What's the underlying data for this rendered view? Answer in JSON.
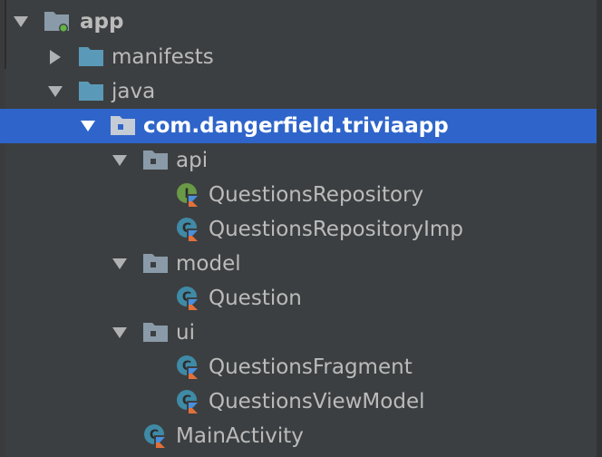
{
  "tree": {
    "root": {
      "label": "app",
      "icon": "module-folder-icon"
    },
    "manifests": {
      "label": "manifests",
      "icon": "folder-icon"
    },
    "java": {
      "label": "java",
      "icon": "source-folder-icon"
    },
    "package": {
      "label": "com.dangerfield.triviaapp",
      "icon": "package-icon"
    },
    "api": {
      "label": "api",
      "icon": "package-icon"
    },
    "questions_repository": {
      "label": "QuestionsRepository",
      "icon": "kotlin-interface-icon"
    },
    "questions_repository_imp": {
      "label": "QuestionsRepositoryImp",
      "icon": "kotlin-class-icon"
    },
    "model": {
      "label": "model",
      "icon": "package-icon"
    },
    "question": {
      "label": "Question",
      "icon": "kotlin-class-icon"
    },
    "ui": {
      "label": "ui",
      "icon": "package-icon"
    },
    "questions_fragment": {
      "label": "QuestionsFragment",
      "icon": "kotlin-class-icon"
    },
    "questions_view_model": {
      "label": "QuestionsViewModel",
      "icon": "kotlin-class-icon"
    },
    "main_activity": {
      "label": "MainActivity",
      "icon": "kotlin-class-icon"
    }
  },
  "colors": {
    "background": "#3c3f41",
    "selection": "#2f65ca",
    "folder": "#5a9ab8",
    "text": "#bbbbbb",
    "interface_badge": "#6a9a47",
    "class_badge": "#3f8aa6"
  }
}
